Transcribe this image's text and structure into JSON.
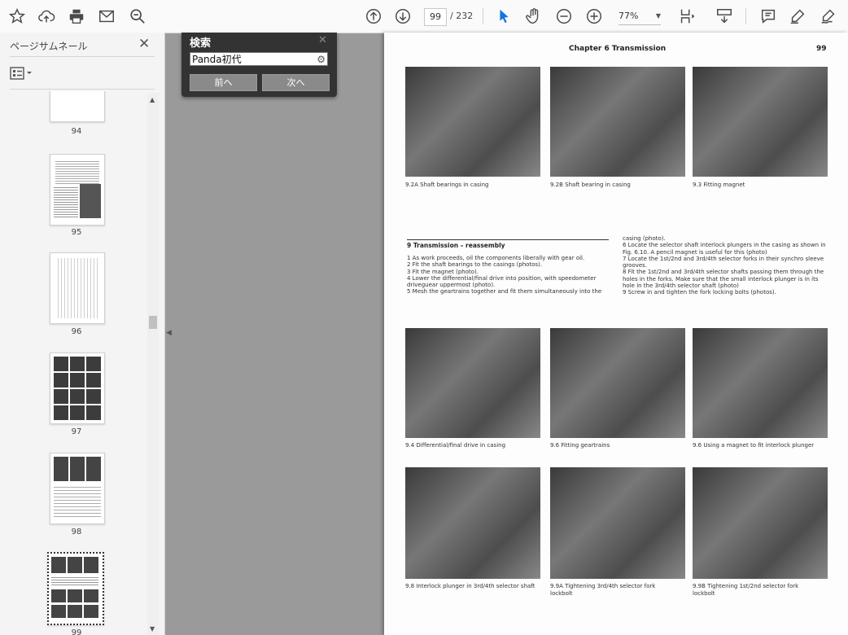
{
  "toolbar": {
    "left_icons": [
      "star-icon",
      "cloud-upload-icon",
      "print-icon",
      "email-icon",
      "zoom-search-icon"
    ],
    "current_page": "99",
    "total_pages": "/ 232",
    "zoom_level": "77%"
  },
  "sidebar": {
    "title": "ページサムネール",
    "close": "✕",
    "thumbnails": [
      {
        "label": "94"
      },
      {
        "label": "95"
      },
      {
        "label": "96"
      },
      {
        "label": "97"
      },
      {
        "label": "98"
      },
      {
        "label": "99"
      }
    ]
  },
  "find_panel": {
    "title": "検索",
    "close": "✕",
    "query": "Panda初代",
    "prev_label": "前へ",
    "next_label": "次へ"
  },
  "document": {
    "header": "Chapter 6 Transmission",
    "page_number": "99",
    "captions_top": [
      "9.2A Shaft bearings in casing",
      "9.2B Shaft bearing in casing",
      "9.3 Fitting magnet"
    ],
    "section_title": "9   Transmission – reassembly",
    "left_column": [
      "1   As work proceeds, oil the components liberally with gear oil.",
      "2   Fit the shaft bearings to the casings (photos).",
      "3   Fit the magnet (photo).",
      "4   Lower the differential/final drive into position, with speedometer driveguear uppermost (photo).",
      "5   Mesh the geartrains together and fit them simultaneously into the"
    ],
    "right_column": [
      "casing (photo).",
      "6   Locate the selector shaft interlock plungers in the casing as shown in Fig. 6.10. A pencil magnet is useful for this (photo)",
      "7   Locate the 1st/2nd and 3rd/4th selector forks in their synchro sleeve grooves.",
      "8   Fit the 1st/2nd and 3rd/4th selector shafts passing them through the holes in the forks. Make sure that the small interlock plunger is in its hole in the 3rd/4th selector shaft (photo)",
      "9   Screw in and tighten the fork locking bolts (photos)."
    ],
    "captions_middle": [
      "9.4 Differential/final drive in casing",
      "9.6 Fitting geartrains",
      "9.6 Using a magnet to fit interlock plunger"
    ],
    "captions_bottom": [
      "9.8 Interlock plunger in 3rd/4th selector shaft",
      "9.9A Tightening 3rd/4th selector fork lockbolt",
      "9.9B Tightening 1st/2nd selector fork lockbolt"
    ]
  },
  "colors": {
    "accent": "#1473e6",
    "find_panel_bg": "#333333",
    "page_bg": "#fdfdfd",
    "canvas_bg": "#9a9a9a"
  }
}
